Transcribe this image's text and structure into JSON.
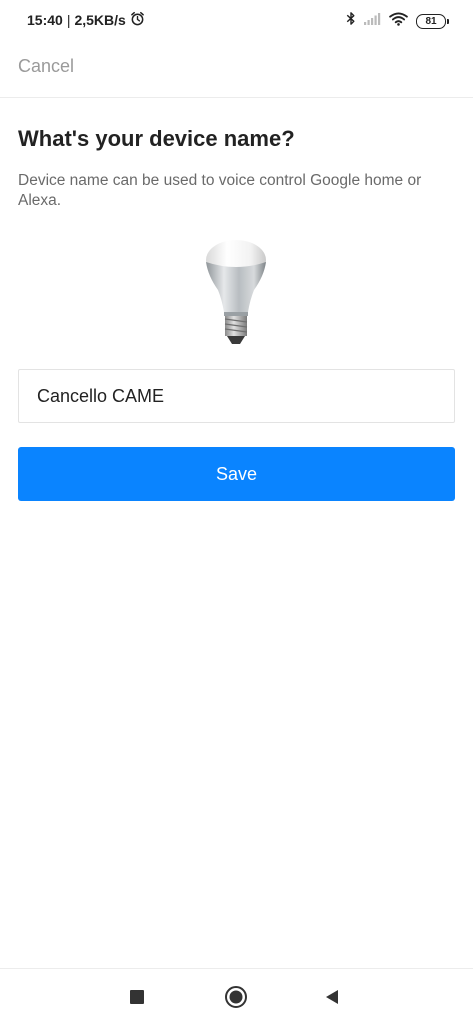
{
  "status_bar": {
    "time": "15:40",
    "separator": "|",
    "speed": "2,5KB/s",
    "battery": "81",
    "icons": [
      "alarm-icon",
      "bluetooth-icon",
      "signal-icon",
      "wifi-icon",
      "battery-icon"
    ]
  },
  "header": {
    "cancel_label": "Cancel"
  },
  "main": {
    "title": "What's your device name?",
    "description": "Device name can be used to voice control Google home or Alexa.",
    "device_icon": "light-bulb-icon",
    "name_input_value": "Cancello CAME",
    "save_label": "Save"
  },
  "nav_bar": {
    "icons": [
      "recent-apps-icon",
      "home-icon",
      "back-icon"
    ]
  },
  "colors": {
    "accent": "#0a84ff",
    "cancel_text": "#9a9a9a",
    "description_text": "#6a6a6a"
  }
}
